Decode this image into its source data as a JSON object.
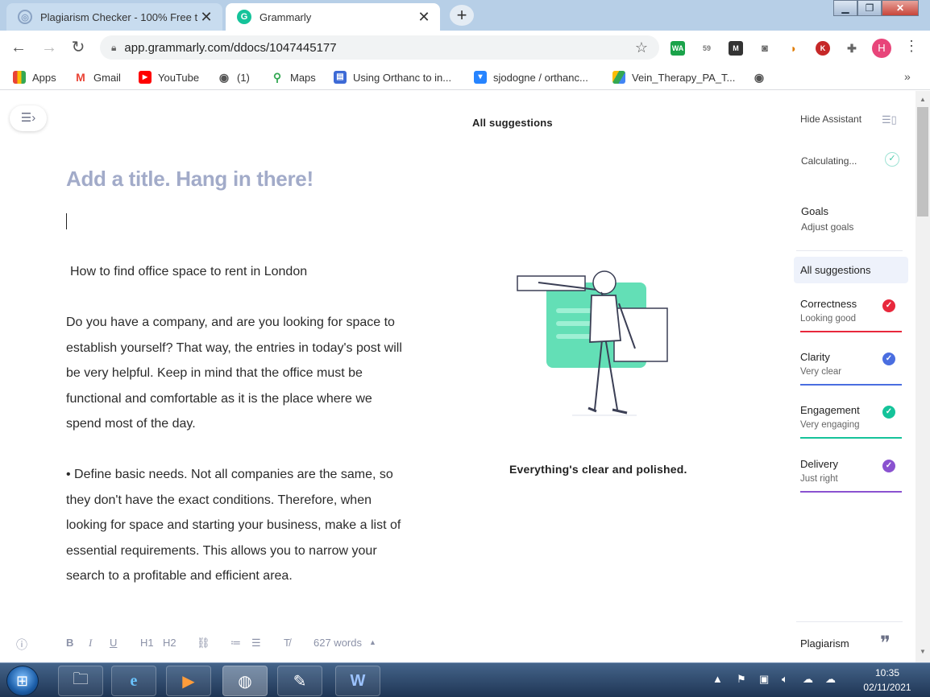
{
  "browser": {
    "tabs": [
      {
        "title": "Plagiarism Checker - 100% Free t",
        "active": false
      },
      {
        "title": "Grammarly",
        "active": true
      }
    ],
    "new_tab": "+",
    "url": "app.grammarly.com/ddocs/1047445177",
    "profile_initial": "H",
    "bookmarks": [
      {
        "label": "Apps",
        "icon": "apps-grid-icon"
      },
      {
        "label": "Gmail",
        "icon": "gmail-icon"
      },
      {
        "label": "YouTube",
        "icon": "youtube-icon"
      },
      {
        "label": "(1)",
        "icon": "globe-icon"
      },
      {
        "label": "Maps",
        "icon": "maps-pin-icon"
      },
      {
        "label": "Using Orthanc to in...",
        "icon": "bookmark-doc-icon"
      },
      {
        "label": "sjodogne / orthanc...",
        "icon": "bitbucket-icon"
      },
      {
        "label": "Vein_Therapy_PA_T...",
        "icon": "google-drive-icon"
      }
    ],
    "extensions": [
      {
        "label": "WA",
        "color": "#1aa34a"
      },
      {
        "label": "59",
        "color": "#888888"
      },
      {
        "label": "M",
        "color": "#333333"
      },
      {
        "label": "K",
        "color": "#c62828"
      }
    ]
  },
  "app": {
    "center_title": "All suggestions",
    "doc_title_placeholder": "Add a title. Hang in there!",
    "paragraphs": [
      " How to find office space to rent in London",
      "Do you have a company, and are you looking for space to establish yourself? That way, the entries in today's post will be very helpful. Keep in mind that the office must be functional and comfortable as it is the place where we spend most of the day.",
      "• Define basic needs. Not all companies are the same, so they don't have the exact conditions. Therefore, when looking for space and starting your business, make a list of essential requirements. This allows you to narrow your search to a profitable and efficient area."
    ],
    "status_message": "Everything's clear and polished.",
    "toolbar": {
      "bold": "B",
      "italic": "I",
      "underline": "U",
      "h1": "H1",
      "h2": "H2",
      "word_count": "627 words"
    },
    "sidebar": {
      "hide_assistant": "Hide Assistant",
      "calculating": "Calculating...",
      "goals": "Goals",
      "adjust_goals": "Adjust goals",
      "all_suggestions": "All suggestions",
      "categories": [
        {
          "name": "Correctness",
          "status": "Looking good",
          "color": "#e8283c"
        },
        {
          "name": "Clarity",
          "status": "Very clear",
          "color": "#4a6ee0"
        },
        {
          "name": "Engagement",
          "status": "Very engaging",
          "color": "#15c39a"
        },
        {
          "name": "Delivery",
          "status": "Just right",
          "color": "#8a52d0"
        }
      ],
      "plagiarism": "Plagiarism"
    }
  },
  "taskbar": {
    "time": "10:35",
    "date": "02/11/2021",
    "apps": [
      "file-explorer-icon",
      "internet-explorer-icon",
      "media-player-icon",
      "chrome-icon",
      "notepad-icon",
      "word-icon"
    ]
  }
}
